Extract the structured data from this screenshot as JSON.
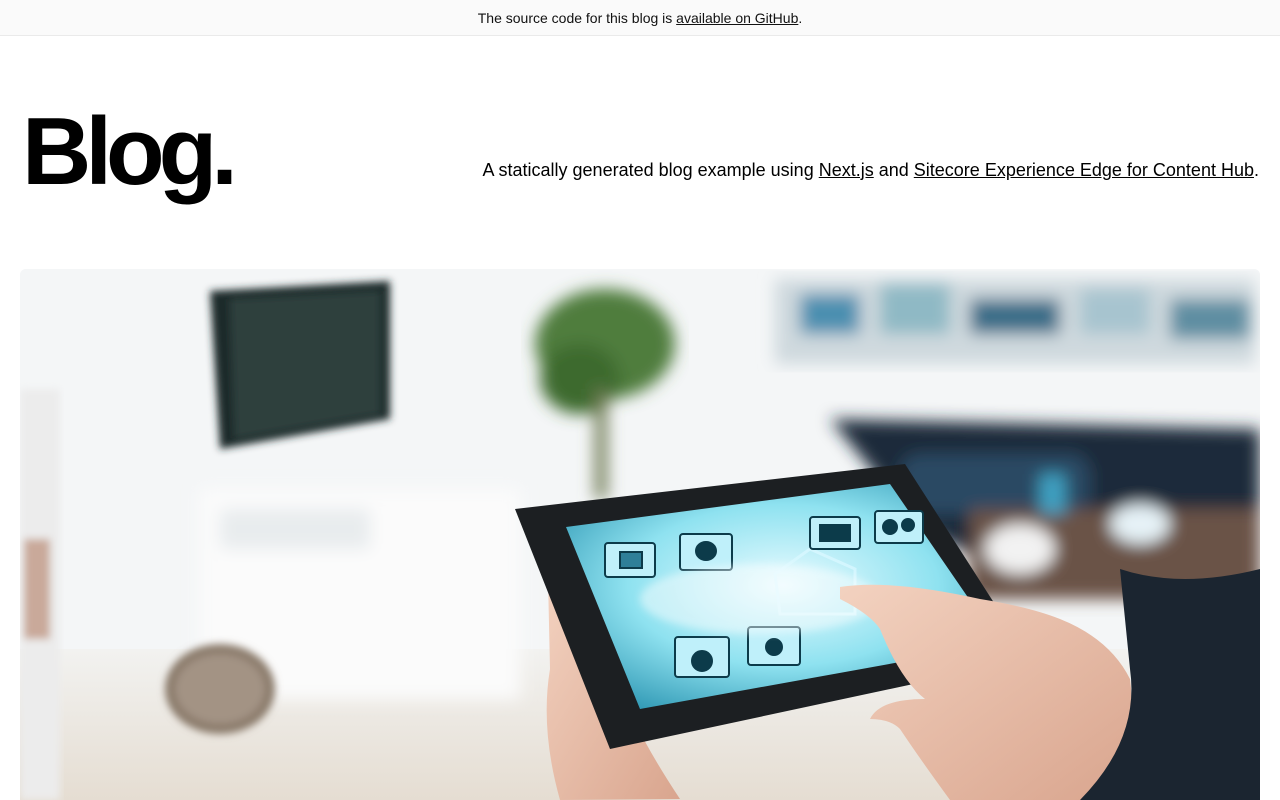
{
  "banner": {
    "prefix": "The source code for this blog is ",
    "link_label": "available on GitHub",
    "suffix": "."
  },
  "header": {
    "brand": "Blog."
  },
  "intro": {
    "prefix": "A statically generated blog example using ",
    "link1": "Next.js",
    "middle": " and ",
    "link2": "Sitecore Experience Edge for Content Hub",
    "suffix": "."
  },
  "hero": {
    "subject": "hands holding a tablet showing smart-home control icons",
    "icons": [
      "folder-icon",
      "lightbulb-icon",
      "house-icon",
      "blinds-icon",
      "settings-icon",
      "washing-machine-icon",
      "music-icon",
      "appliance-icon"
    ]
  },
  "colors": {
    "banner_bg": "#fafafa",
    "banner_border": "#eaeaea",
    "text": "#000000",
    "screen_glow": "#6fd3e6"
  }
}
